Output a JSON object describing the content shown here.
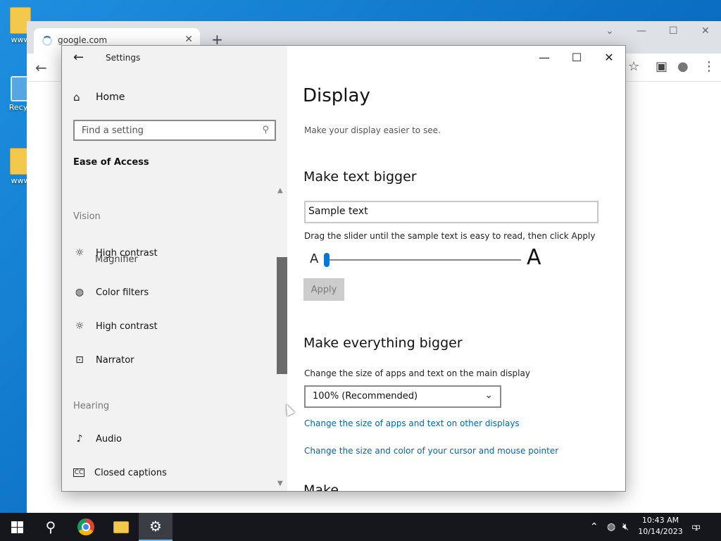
{
  "desktop": {
    "icons": [
      {
        "label": "www",
        "kind": "folder-icon"
      },
      {
        "label": "Recyc",
        "kind": "recycle-bin-icon"
      },
      {
        "label": "www",
        "kind": "folder-icon"
      }
    ]
  },
  "browser": {
    "tab_title": "google.com",
    "tab_close": "✕",
    "new_tab": "+",
    "controls": {
      "tabsearch": "⌄",
      "minimize": "—",
      "maximize": "☐",
      "close": "✕"
    },
    "back": "←",
    "toolbar_icons": {
      "bookmark": "☆",
      "sidepanel": "▣",
      "profile": "●",
      "menu": "⋮"
    }
  },
  "settings": {
    "app_title": "Settings",
    "back": "←",
    "home_label": "Home",
    "search_placeholder": "Find a setting",
    "section": "Ease of Access",
    "nav": {
      "vision_header": "Vision",
      "ghost_magnifier": "Magnifier",
      "items_vision": [
        {
          "label": "High contrast",
          "icon": "sun-icon"
        },
        {
          "label": "Color filters",
          "icon": "palette-icon"
        },
        {
          "label": "High contrast",
          "icon": "sun-icon"
        },
        {
          "label": "Narrator",
          "icon": "narrator-icon"
        }
      ],
      "hearing_header": "Hearing",
      "items_hearing": [
        {
          "label": "Audio",
          "icon": "speaker-icon"
        },
        {
          "label": "Closed captions",
          "icon": "cc-icon"
        }
      ]
    },
    "window_controls": {
      "minimize": "—",
      "maximize": "☐",
      "close": "✕"
    },
    "page": {
      "title": "Display",
      "subtitle": "Make your display easier to see.",
      "text_bigger": {
        "heading": "Make text bigger",
        "sample": "Sample text",
        "hint": "Drag the slider until the sample text is easy to read, then click Apply",
        "slider_min_label": "A",
        "slider_max_label": "A",
        "slider_value_percent": 0,
        "apply_label": "Apply"
      },
      "everything_bigger": {
        "heading": "Make everything bigger",
        "label": "Change the size of apps and text on the main display",
        "scale_value": "100% (Recommended)",
        "link_other_displays": "Change the size of apps and text on other displays",
        "link_cursor": "Change the size and color of your cursor and mouse pointer"
      },
      "next_heading_cut": "Make ..."
    }
  },
  "taskbar": {
    "time": "10:43 AM",
    "date": "10/14/2023",
    "notification_count": "1",
    "tray_icons": [
      "chevron-up-icon",
      "network-icon",
      "volume-muted-icon"
    ],
    "colors": {
      "background": "#15171c",
      "active_indicator": "#76b9ed"
    }
  },
  "colors": {
    "accent": "#0078d7",
    "link": "#0067b8",
    "desktop": "#0b6fc3"
  }
}
